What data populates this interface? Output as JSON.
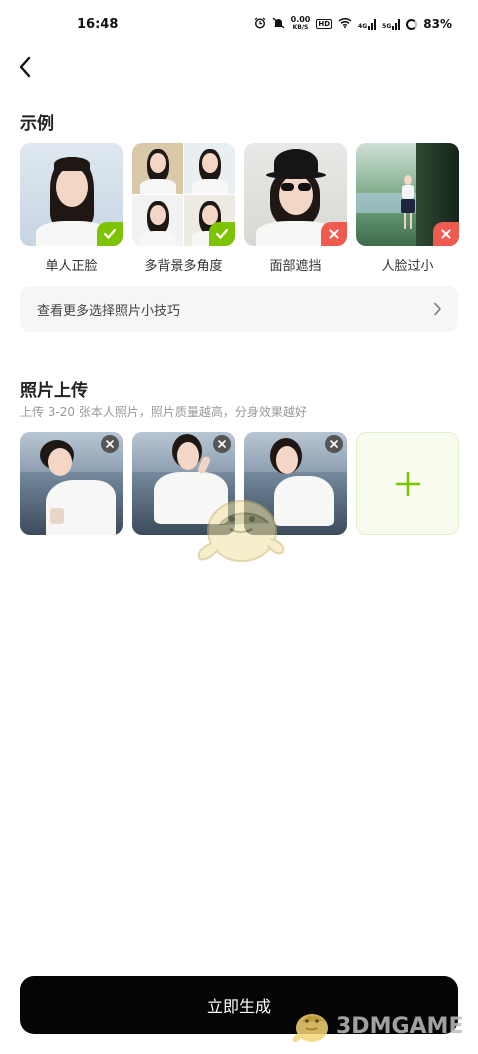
{
  "status_bar": {
    "time": "16:48",
    "net_speed_value": "0.00",
    "net_speed_unit": "KB/S",
    "hd_label": "HD",
    "signal_label_1": "4G",
    "signal_label_2": "5G",
    "battery": "83%"
  },
  "nav": {
    "back_icon": "chevron-left-icon"
  },
  "examples": {
    "title": "示例",
    "items": [
      {
        "caption": "单人正脸",
        "status": "ok"
      },
      {
        "caption": "多背景多角度",
        "status": "ok"
      },
      {
        "caption": "面部遮挡",
        "status": "bad"
      },
      {
        "caption": "人脸过小",
        "status": "bad"
      }
    ]
  },
  "tips": {
    "label": "查看更多选择照片小技巧"
  },
  "upload": {
    "title": "照片上传",
    "subtitle": "上传 3-20 张本人照片，照片质量越高，分身效果越好",
    "photo_count": 3
  },
  "actions": {
    "generate_label": "立即生成"
  },
  "watermark": {
    "text": "3DMGAME"
  },
  "colors": {
    "accent_green": "#7cc400",
    "error_red": "#f05a4f",
    "button_black": "#050505"
  }
}
